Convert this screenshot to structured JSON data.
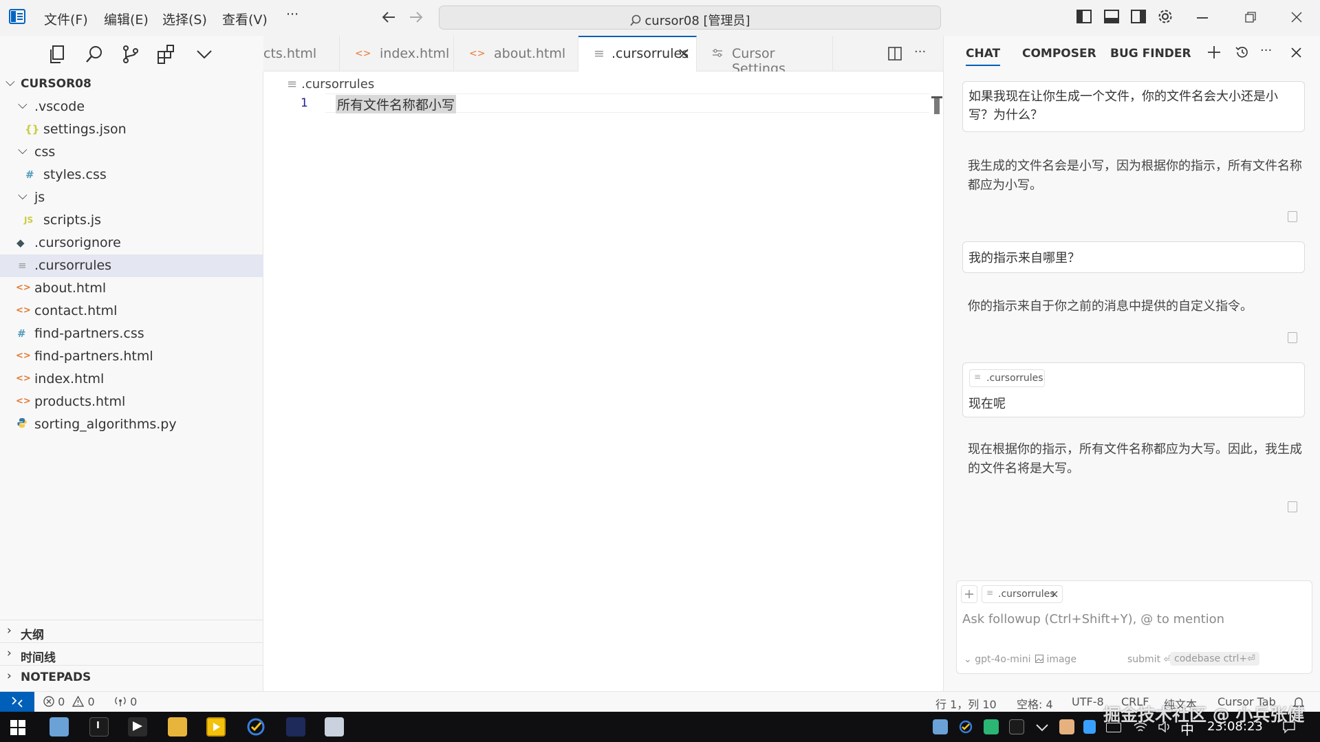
{
  "titlebar": {
    "menus": [
      "文件(F)",
      "编辑(E)",
      "选择(S)",
      "查看(V)",
      "···"
    ],
    "search_text": "cursor08 [管理员]"
  },
  "explorer": {
    "root": "CURSOR08",
    "items": [
      {
        "label": ".vscode",
        "kind": "folder"
      },
      {
        "label": "settings.json",
        "kind": "json"
      },
      {
        "label": "css",
        "kind": "folder"
      },
      {
        "label": "styles.css",
        "kind": "css"
      },
      {
        "label": "js",
        "kind": "folder"
      },
      {
        "label": "scripts.js",
        "kind": "js"
      },
      {
        "label": ".cursorignore",
        "kind": "ignore"
      },
      {
        "label": ".cursorrules",
        "kind": "rules"
      },
      {
        "label": "about.html",
        "kind": "html"
      },
      {
        "label": "contact.html",
        "kind": "html"
      },
      {
        "label": "find-partners.css",
        "kind": "css"
      },
      {
        "label": "find-partners.html",
        "kind": "html"
      },
      {
        "label": "index.html",
        "kind": "html"
      },
      {
        "label": "products.html",
        "kind": "html"
      },
      {
        "label": "sorting_algorithms.py",
        "kind": "py"
      }
    ],
    "sections": [
      "大纲",
      "时间线",
      "NOTEPADS"
    ]
  },
  "tabs": [
    {
      "label": "cts.html"
    },
    {
      "label": "index.html"
    },
    {
      "label": "about.html"
    },
    {
      "label": ".cursorrules"
    },
    {
      "label": "Cursor Settings"
    }
  ],
  "editor": {
    "breadcrumb": ".cursorrules",
    "line_number": "1",
    "line_text": "所有文件名称都小写"
  },
  "chat": {
    "tabs": [
      "CHAT",
      "COMPOSER",
      "BUG FINDER"
    ],
    "q1": "如果我现在让你生成一个文件，你的文件名会大小还是小写？为什么？",
    "a1": "我生成的文件名会是小写，因为根据你的指示，所有文件名称都应为小写。",
    "q2": "我的指示来自哪里？",
    "a2": "你的指示来自于你之前的消息中提供的自定义指令。",
    "q3_chip": ".cursorrules",
    "q3": "现在呢",
    "a3": "现在根据你的指示，所有文件名称都应为大写。因此，我生成的文件名将是大写。",
    "input_chip": ".cursorrules",
    "placeholder": "Ask followup (Ctrl+Shift+Y), @ to mention",
    "model": "gpt-4o-mini",
    "image_label": "image",
    "submit_label": "submit ⏎",
    "codebase_label": "codebase ctrl+⏎"
  },
  "statusbar": {
    "errors": "0",
    "warnings": "0",
    "ports": "0",
    "position": "行 1，列 10",
    "spaces": "空格: 4",
    "encoding": "UTF-8",
    "eol": "CRLF",
    "language": "纯文本",
    "cursor_tab": "Cursor Tab"
  },
  "taskbar": {
    "ime": "中",
    "time": "23:08:23",
    "watermark": "掘金技术社区 @ 小兵张健"
  },
  "colors": {
    "accent": "#005fb8",
    "selection": "#e4e6f1",
    "html_icon": "#e37933",
    "css_icon": "#519aba",
    "js_icon": "#cbcb41"
  }
}
